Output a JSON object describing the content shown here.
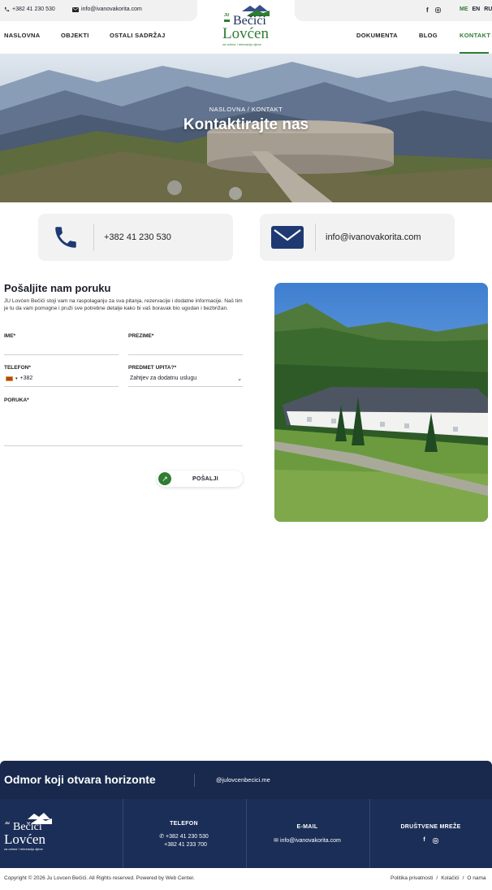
{
  "topbar": {
    "phone": "+382 41 230 530",
    "email": "info@ivanovakorita.com",
    "social": [
      "facebook-icon",
      "instagram-icon"
    ],
    "languages": [
      "ME",
      "EN",
      "RU"
    ],
    "active_language": "ME"
  },
  "nav": {
    "left": [
      "NASLOVNA",
      "OBJEKTI",
      "OSTALI SADRŽAJ"
    ],
    "right": [
      "DOKUMENTA",
      "BLOG",
      "KONTAKT"
    ],
    "active": "KONTAKT"
  },
  "logo": {
    "prefix": "JU",
    "line1": "Bečići",
    "line2": "Lovćen",
    "tagline": "za odmor i rekreaciju djece"
  },
  "hero": {
    "breadcrumb": "NASLOVNA / KONTAKT",
    "title": "Kontaktirajte nas"
  },
  "contact_cards": {
    "phone": "+382 41 230 530",
    "email": "info@ivanovakorita.com"
  },
  "form": {
    "title": "Pošaljite nam poruku",
    "description": "JU Lovćen Bečići stoji vam na raspolaganju za sva pitanja, rezervacije i dodatne informacije. Naš tim je tu da vam pomogne i pruži sve potrebne detalje kako bi vaš boravak bio ugodan i bezbrižan.",
    "labels": {
      "first_name": "IME*",
      "last_name": "PREZIME*",
      "phone": "TELEFON*",
      "subject": "PREDMET UPITA?*",
      "message": "PORUKA*"
    },
    "phone_prefix": "+382",
    "subject_selected": "Zahtjev za dodatnu uslugu",
    "send_label": "POŠALJI"
  },
  "footer": {
    "slogan": "Odmor koji otvara horizonte",
    "handle": "@julovcenbecici.me",
    "phone_heading": "TELEFON",
    "phone_1": "+382 41 230 530",
    "phone_2": "+382 41 233 700",
    "email_heading": "E-MAIL",
    "email": "info@ivanovakorita.com",
    "social_heading": "DRUŠTVENE MREŽE",
    "copyright": "Copyright © 2026 Ju Lovcen Bečići. All Rights reserved. Powered by Web Center.",
    "links": [
      "Politika privatnosti",
      "Kolačići",
      "O nama"
    ]
  },
  "colors": {
    "accent": "#2e7d32",
    "navy": "#1b2e57",
    "card_bg": "#f2f2f2"
  }
}
